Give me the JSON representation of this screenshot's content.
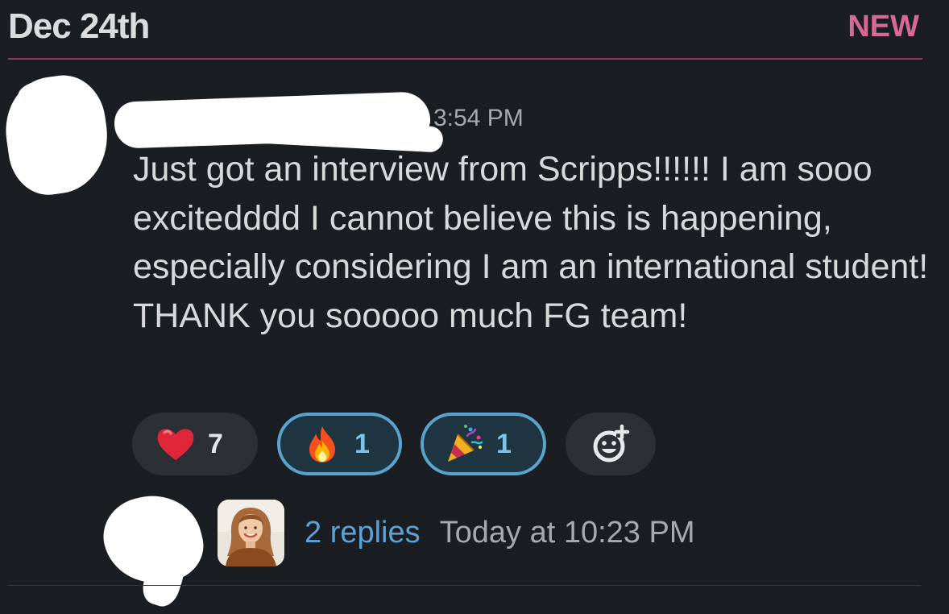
{
  "date_header": {
    "label": "Dec 24th",
    "new_badge": "NEW"
  },
  "message": {
    "time": "3:54 PM",
    "text": "Just got an interview from Scripps!!!!!! I am sooo excitedddd I cannot believe this is happening, especially considering I am an international student! THANK you sooooo much FG team!"
  },
  "reactions": [
    {
      "icon": "red-heart-icon",
      "count": "7",
      "active": false
    },
    {
      "icon": "fire-icon",
      "count": "1",
      "active": true
    },
    {
      "icon": "party-popper-icon",
      "count": "1",
      "active": true
    }
  ],
  "add_reaction": {
    "icon": "add-reaction-icon"
  },
  "thread": {
    "replies": "2 replies",
    "last_reply": "Today at 10:23 PM"
  },
  "colors": {
    "background": "#1a1d21",
    "new_divider": "#8a3b5a",
    "new_badge": "#d66b92",
    "link": "#5aa3d8",
    "active_reaction_border": "#5aa3cc"
  }
}
